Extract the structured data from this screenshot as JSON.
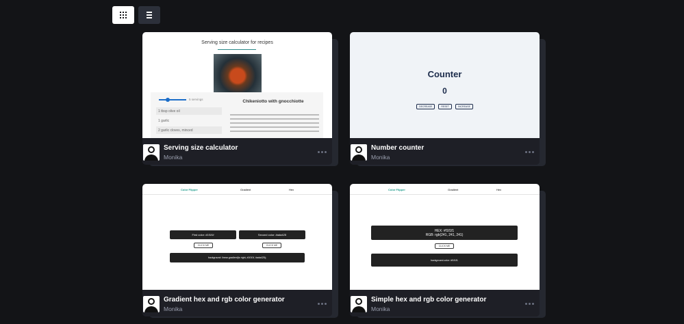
{
  "toolbar": {
    "grid_view": "grid-view",
    "list_view": "list-view"
  },
  "cards": [
    {
      "title": "Serving size calculator",
      "author": "Monika",
      "preview": {
        "heading": "Serving size calculator for recipes",
        "servings": "5 servings",
        "ingredients": [
          "1 tbsp olive oil",
          "1 garlic",
          "2 garlic cloves, minced"
        ],
        "recipe_title": "Chikeniotto with gnocchiotte"
      }
    },
    {
      "title": "Number counter",
      "author": "Monika",
      "preview": {
        "heading": "Counter",
        "value": "0",
        "buttons": [
          "DECREASE",
          "RESET",
          "INCREASE"
        ]
      }
    },
    {
      "title": "Gradient hex and rgb color generator",
      "author": "Monika",
      "preview": {
        "nav": [
          "Color Flipper",
          "Gradient",
          "Hex"
        ],
        "first_color": "First color: #1f1f1f",
        "second_color": "Second color: #ada425",
        "click_me": "CLICK ME",
        "gradient_text": "background: linear-gradient(to right, #1f1f1f, #ada425);"
      }
    },
    {
      "title": "Simple hex and rgb color generator",
      "author": "Monika",
      "preview": {
        "nav": [
          "Color Flipper",
          "Gradient",
          "Hex"
        ],
        "hex": "HEX: #f1f1f1",
        "rgb": "RGB: rgb(241, 241, 241)",
        "click_me": "CLICK ME",
        "bg_text": "background-color: #f1f1f1"
      }
    }
  ],
  "colors": {
    "background": "#131417",
    "card": "#1e1f26",
    "accent": "#1a9a8a"
  }
}
